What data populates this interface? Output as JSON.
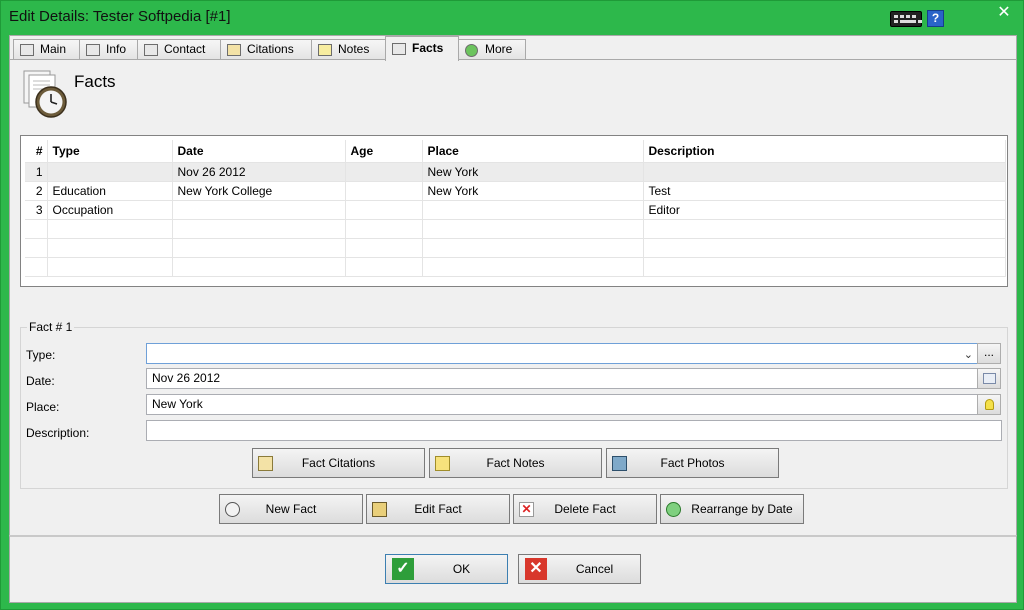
{
  "window": {
    "title": "Edit Details: Tester Softpedia [#1]",
    "help_label": "?",
    "close_label": "✕"
  },
  "tabs": [
    {
      "label": "Main",
      "icon": "person-card-icon"
    },
    {
      "label": "Info",
      "icon": "info-card-icon"
    },
    {
      "label": "Contact",
      "icon": "house-icon"
    },
    {
      "label": "Citations",
      "icon": "citation-icon"
    },
    {
      "label": "Notes",
      "icon": "note-icon"
    },
    {
      "label": "Facts",
      "icon": "clock-card-icon",
      "active": true
    },
    {
      "label": "More",
      "icon": "plus-icon"
    }
  ],
  "page": {
    "title": "Facts"
  },
  "table": {
    "columns": [
      "#",
      "Type",
      "Date",
      "Age",
      "Place",
      "Description"
    ],
    "rows": [
      [
        "1",
        "",
        "Nov 26 2012",
        "",
        "New York",
        ""
      ],
      [
        "2",
        "Education",
        "New York College",
        "",
        "New York",
        "Test"
      ],
      [
        "3",
        "Occupation",
        "",
        "",
        "",
        "Editor"
      ]
    ]
  },
  "fact": {
    "legend": "Fact # 1",
    "type_label": "Type:",
    "type_value": "",
    "date_label": "Date:",
    "date_value": "Nov 26 2012",
    "place_label": "Place:",
    "place_value": "New York",
    "description_label": "Description:",
    "description_value": "",
    "browse_label": "..."
  },
  "fact_buttons": {
    "citations": "Fact Citations",
    "notes": "Fact Notes",
    "photos": "Fact Photos"
  },
  "actions": {
    "new": "New Fact",
    "edit": "Edit Fact",
    "delete": "Delete Fact",
    "rearrange": "Rearrange by Date"
  },
  "dialog": {
    "ok": "OK",
    "cancel": "Cancel"
  },
  "colors": {
    "frame": "#2db84b",
    "ok_check": "#2e9e3a",
    "cancel_x": "#d8372b"
  }
}
